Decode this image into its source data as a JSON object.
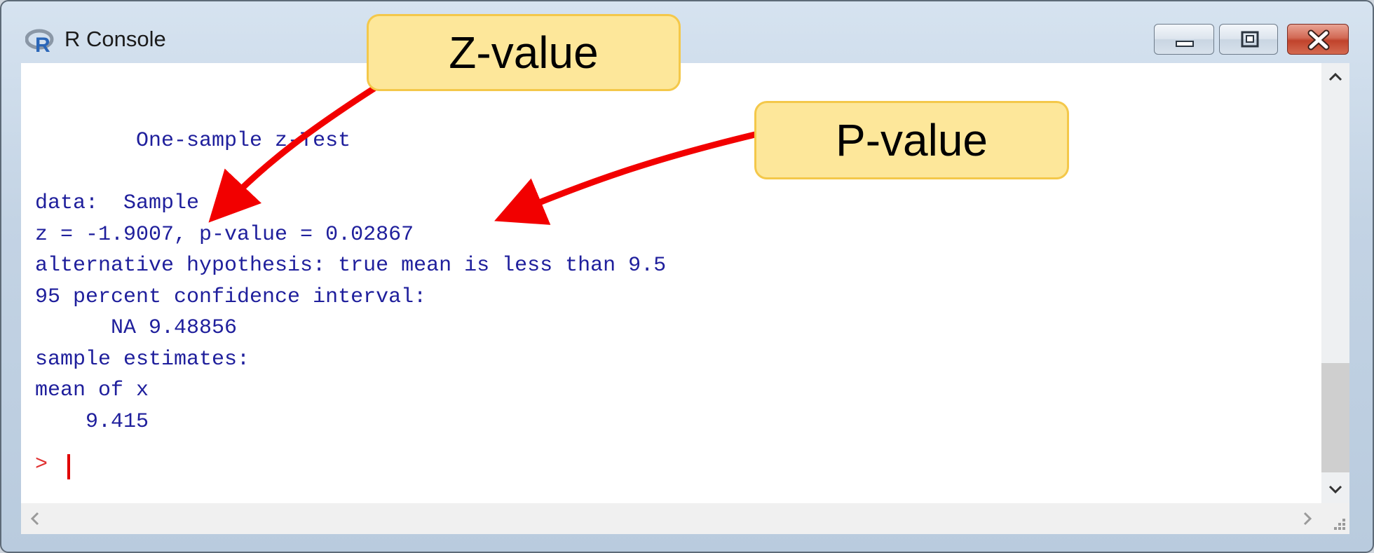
{
  "window": {
    "title": "R Console",
    "controls": {
      "minimize": "minimize",
      "maximize": "maximize",
      "close": "close"
    }
  },
  "console": {
    "lines": [
      "",
      "",
      "        One-sample z-Test",
      "",
      "data:  Sample",
      "z = -1.9007, p-value = 0.02867",
      "alternative hypothesis: true mean is less than 9.5",
      "95 percent confidence interval:",
      "      NA 9.48856",
      "sample estimates:",
      "mean of x",
      "    9.415"
    ],
    "prompt": ">"
  },
  "annotations": {
    "z_value": "Z-value",
    "p_value": "P-value"
  },
  "colors": {
    "console_text": "#1f1f9c",
    "prompt": "#e03030",
    "arrow": "#f20000",
    "callout_fill": "#fde79a",
    "callout_border": "#f4c84a"
  },
  "icons": {
    "app": "r-logo-icon",
    "minimize": "minimize-icon",
    "maximize": "maximize-icon",
    "close": "close-icon",
    "scroll_up": "chevron-up-icon",
    "scroll_down": "chevron-down-icon",
    "scroll_left": "chevron-left-icon",
    "scroll_right": "chevron-right-icon",
    "resize": "resize-grip-icon"
  }
}
